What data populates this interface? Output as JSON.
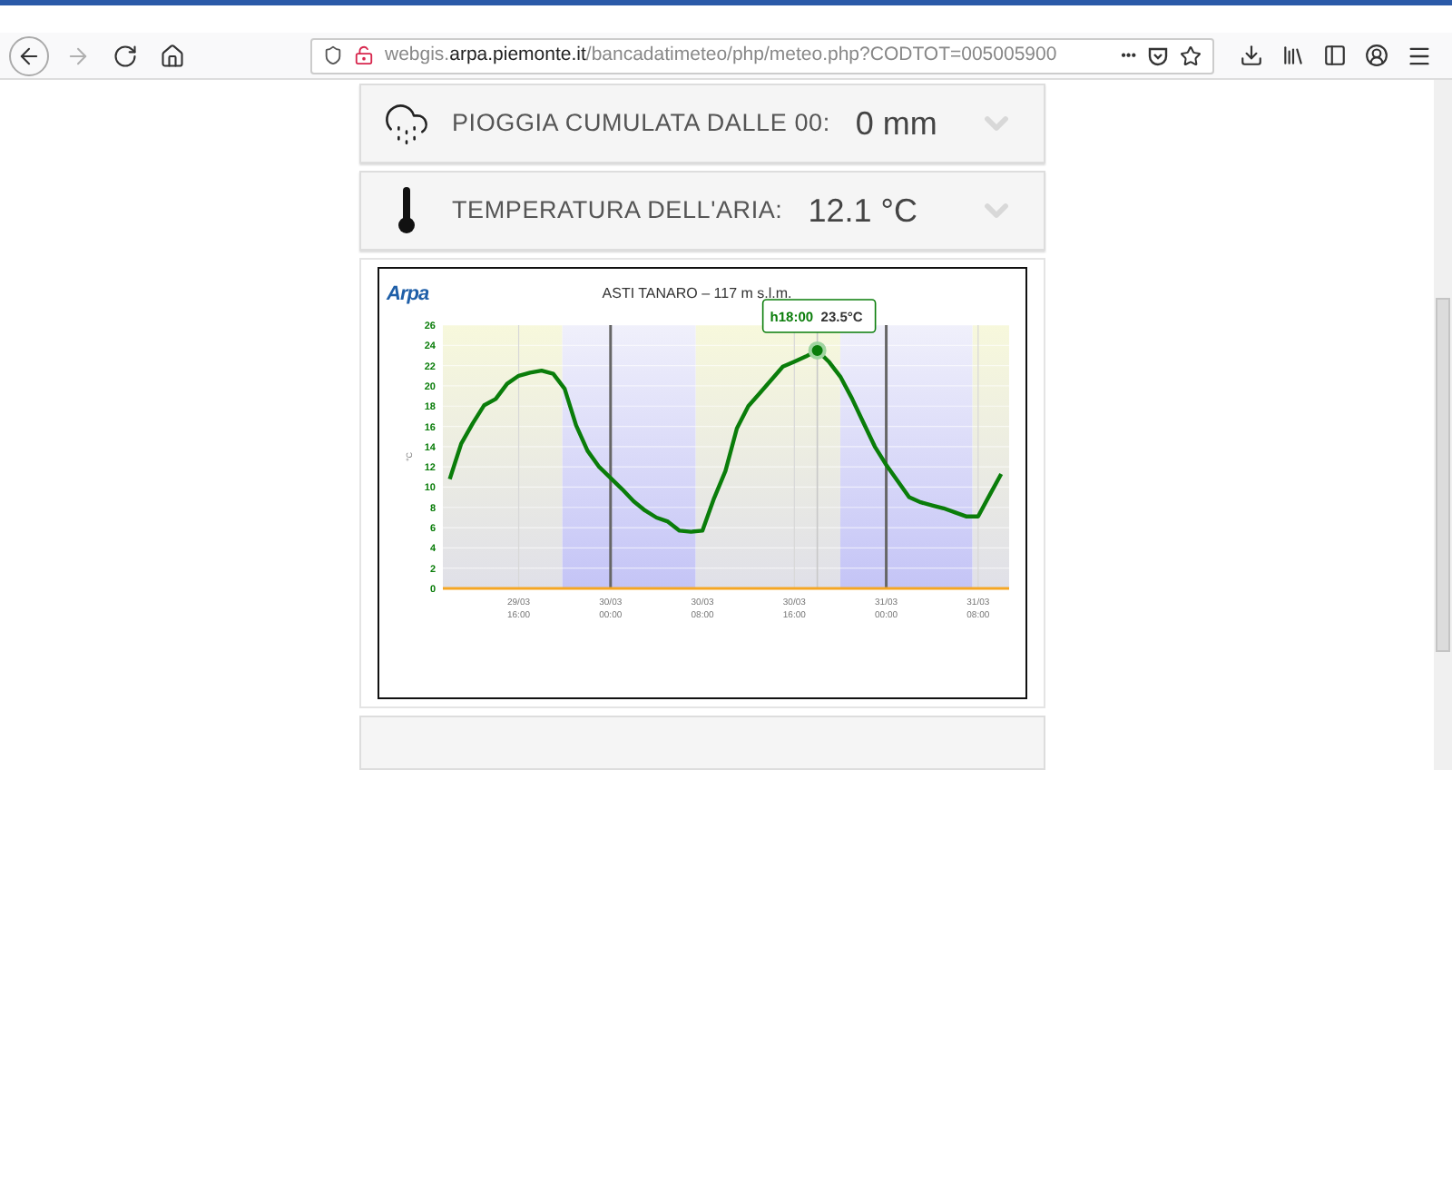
{
  "browser": {
    "nav": [
      {
        "kind": "back",
        "disabled": false
      },
      {
        "kind": "forward",
        "disabled": true
      },
      {
        "kind": "reload",
        "disabled": false
      },
      {
        "kind": "home",
        "disabled": false
      }
    ],
    "url": {
      "prefix": "webgis.",
      "domain": "arpa.piemonte.it",
      "path": "/bancadatimeteo/php/meteo.php?CODTOT=005005900"
    },
    "more": "•••"
  },
  "panels": [
    {
      "kind": "rain",
      "label": "PIOGGIA CUMULATA DALLE 00:",
      "value": "0 mm"
    },
    {
      "kind": "temperature",
      "label": "TEMPERATURA DELL'ARIA:",
      "value": "12.1 °C"
    }
  ],
  "chart": {
    "logo": "Arpa",
    "chart_data": {
      "type": "line",
      "title": "ASTI TANARO – 117 m s.l.m.",
      "ylabel": "°C",
      "categories": [
        null,
        null,
        null,
        null,
        null,
        null,
        "29/03 16:00",
        null,
        null,
        null,
        null,
        null,
        null,
        null,
        "30/03 00:00",
        null,
        null,
        null,
        null,
        null,
        null,
        null,
        "30/03 08:00",
        null,
        null,
        null,
        null,
        null,
        null,
        null,
        "30/03 16:00",
        null,
        null,
        null,
        null,
        null,
        null,
        null,
        "31/03 00:00",
        null,
        null,
        null,
        null,
        null,
        null,
        null,
        "31/03 08:00",
        null,
        null
      ],
      "series": [
        {
          "color": "#0a7d0a",
          "values": [
            10.8,
            14.3,
            16.3,
            18.1,
            18.7,
            20.2,
            21.0,
            21.3,
            21.5,
            21.2,
            19.7,
            16.1,
            13.6,
            12.0,
            10.9,
            9.8,
            8.6,
            7.7,
            7.0,
            6.6,
            5.7,
            5.6,
            5.7,
            8.9,
            11.6,
            15.8,
            18.0,
            19.3,
            20.6,
            21.9,
            22.4,
            22.9,
            23.5,
            22.4,
            20.9,
            18.8,
            16.4,
            14.0,
            12.2,
            10.6,
            9.0,
            8.5,
            8.2,
            7.9,
            7.5,
            7.1,
            7.1,
            9.2,
            11.3
          ]
        }
      ],
      "ylim": [
        0,
        26
      ],
      "yticks": [
        0,
        2,
        4,
        6,
        8,
        10,
        12,
        14,
        16,
        18,
        20,
        22,
        24,
        26
      ],
      "grid": true,
      "annotations": [
        {
          "y": 23.5,
          "text": "h18:00 23.5°C"
        }
      ]
    }
  }
}
